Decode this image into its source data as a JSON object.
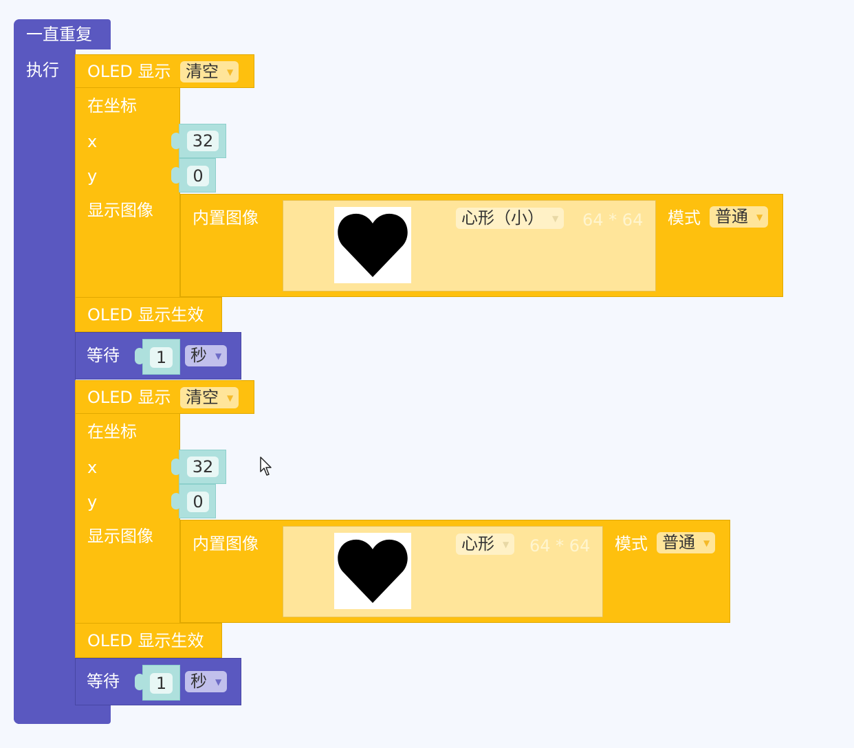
{
  "loop": {
    "title": "一直重复",
    "do_label": "执行"
  },
  "sequence": [
    {
      "clear": {
        "label": "OLED 显示",
        "option": "清空"
      },
      "draw": {
        "at_label": "在坐标",
        "x_label": "x",
        "x_value": "32",
        "y_label": "y",
        "y_value": "0",
        "show_label": "显示图像",
        "builtin_label": "内置图像",
        "image_name": "心形（小）",
        "image_icon": "heart-icon",
        "size_text": "64 * 64",
        "mode_label": "模式",
        "mode_value": "普通"
      },
      "refresh_label": "OLED 显示生效",
      "wait": {
        "label": "等待",
        "value": "1",
        "unit": "秒"
      }
    },
    {
      "clear": {
        "label": "OLED 显示",
        "option": "清空"
      },
      "draw": {
        "at_label": "在坐标",
        "x_label": "x",
        "x_value": "32",
        "y_label": "y",
        "y_value": "0",
        "show_label": "显示图像",
        "builtin_label": "内置图像",
        "image_name": "心形",
        "image_icon": "heart-icon",
        "size_text": "64 * 64",
        "mode_label": "模式",
        "mode_value": "普通"
      },
      "refresh_label": "OLED 显示生效",
      "wait": {
        "label": "等待",
        "value": "1",
        "unit": "秒"
      }
    }
  ],
  "colors": {
    "loop": "#5a58c0",
    "oled": "#fec00e",
    "number": "#aee0dd",
    "workspace": "#f5f8fe"
  }
}
